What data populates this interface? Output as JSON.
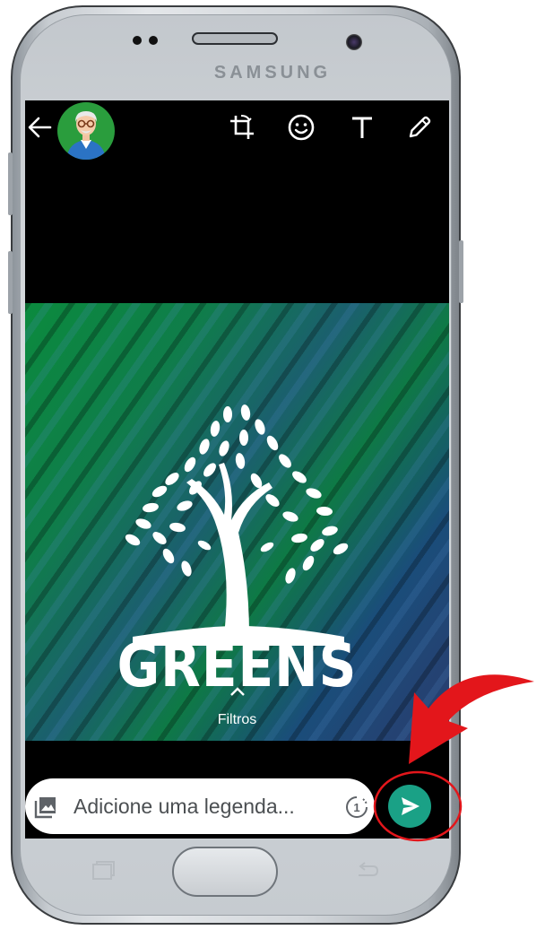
{
  "device": {
    "brand": "SAMSUNG"
  },
  "toolbar": {
    "back_icon": "arrow-left-icon",
    "crop_icon": "crop-rotate-icon",
    "emoji_icon": "emoji-icon",
    "text_icon": "text-T-icon",
    "draw_icon": "pencil-icon"
  },
  "image": {
    "logo_text": "GREENS"
  },
  "filters": {
    "label": "Filtros"
  },
  "caption": {
    "placeholder": "Adicione uma legenda...",
    "gallery_icon": "image-icon",
    "view_once_icon": "view-once-1-icon",
    "view_once_label": "1"
  },
  "send": {
    "icon": "send-icon"
  },
  "colors": {
    "send_button": "#1aa186",
    "avatar_bg": "#2a9d3d",
    "highlight": "#e3161b"
  }
}
